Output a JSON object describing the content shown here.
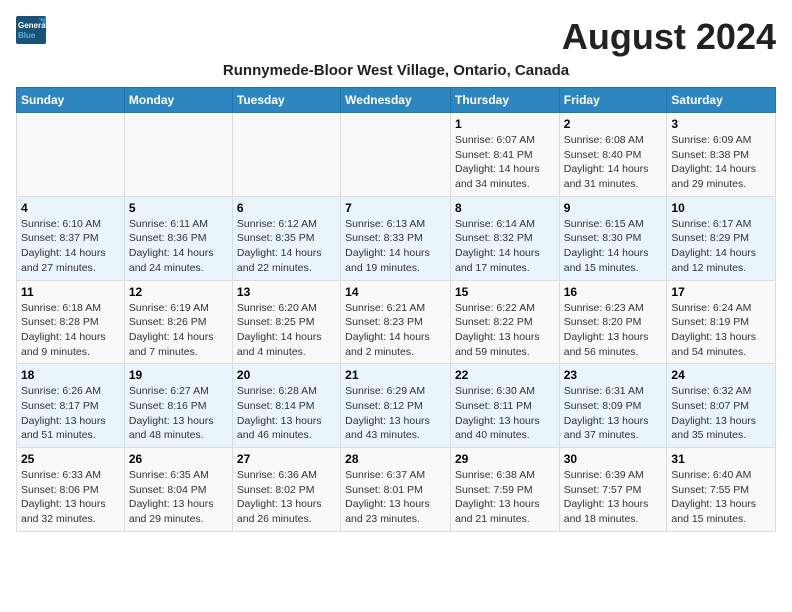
{
  "logo": {
    "line1": "General",
    "line2": "Blue"
  },
  "title": "August 2024",
  "subtitle": "Runnymede-Bloor West Village, Ontario, Canada",
  "days_of_week": [
    "Sunday",
    "Monday",
    "Tuesday",
    "Wednesday",
    "Thursday",
    "Friday",
    "Saturday"
  ],
  "weeks": [
    [
      {
        "day": "",
        "info": ""
      },
      {
        "day": "",
        "info": ""
      },
      {
        "day": "",
        "info": ""
      },
      {
        "day": "",
        "info": ""
      },
      {
        "day": "1",
        "info": "Sunrise: 6:07 AM\nSunset: 8:41 PM\nDaylight: 14 hours\nand 34 minutes."
      },
      {
        "day": "2",
        "info": "Sunrise: 6:08 AM\nSunset: 8:40 PM\nDaylight: 14 hours\nand 31 minutes."
      },
      {
        "day": "3",
        "info": "Sunrise: 6:09 AM\nSunset: 8:38 PM\nDaylight: 14 hours\nand 29 minutes."
      }
    ],
    [
      {
        "day": "4",
        "info": "Sunrise: 6:10 AM\nSunset: 8:37 PM\nDaylight: 14 hours\nand 27 minutes."
      },
      {
        "day": "5",
        "info": "Sunrise: 6:11 AM\nSunset: 8:36 PM\nDaylight: 14 hours\nand 24 minutes."
      },
      {
        "day": "6",
        "info": "Sunrise: 6:12 AM\nSunset: 8:35 PM\nDaylight: 14 hours\nand 22 minutes."
      },
      {
        "day": "7",
        "info": "Sunrise: 6:13 AM\nSunset: 8:33 PM\nDaylight: 14 hours\nand 19 minutes."
      },
      {
        "day": "8",
        "info": "Sunrise: 6:14 AM\nSunset: 8:32 PM\nDaylight: 14 hours\nand 17 minutes."
      },
      {
        "day": "9",
        "info": "Sunrise: 6:15 AM\nSunset: 8:30 PM\nDaylight: 14 hours\nand 15 minutes."
      },
      {
        "day": "10",
        "info": "Sunrise: 6:17 AM\nSunset: 8:29 PM\nDaylight: 14 hours\nand 12 minutes."
      }
    ],
    [
      {
        "day": "11",
        "info": "Sunrise: 6:18 AM\nSunset: 8:28 PM\nDaylight: 14 hours\nand 9 minutes."
      },
      {
        "day": "12",
        "info": "Sunrise: 6:19 AM\nSunset: 8:26 PM\nDaylight: 14 hours\nand 7 minutes."
      },
      {
        "day": "13",
        "info": "Sunrise: 6:20 AM\nSunset: 8:25 PM\nDaylight: 14 hours\nand 4 minutes."
      },
      {
        "day": "14",
        "info": "Sunrise: 6:21 AM\nSunset: 8:23 PM\nDaylight: 14 hours\nand 2 minutes."
      },
      {
        "day": "15",
        "info": "Sunrise: 6:22 AM\nSunset: 8:22 PM\nDaylight: 13 hours\nand 59 minutes."
      },
      {
        "day": "16",
        "info": "Sunrise: 6:23 AM\nSunset: 8:20 PM\nDaylight: 13 hours\nand 56 minutes."
      },
      {
        "day": "17",
        "info": "Sunrise: 6:24 AM\nSunset: 8:19 PM\nDaylight: 13 hours\nand 54 minutes."
      }
    ],
    [
      {
        "day": "18",
        "info": "Sunrise: 6:26 AM\nSunset: 8:17 PM\nDaylight: 13 hours\nand 51 minutes."
      },
      {
        "day": "19",
        "info": "Sunrise: 6:27 AM\nSunset: 8:16 PM\nDaylight: 13 hours\nand 48 minutes."
      },
      {
        "day": "20",
        "info": "Sunrise: 6:28 AM\nSunset: 8:14 PM\nDaylight: 13 hours\nand 46 minutes."
      },
      {
        "day": "21",
        "info": "Sunrise: 6:29 AM\nSunset: 8:12 PM\nDaylight: 13 hours\nand 43 minutes."
      },
      {
        "day": "22",
        "info": "Sunrise: 6:30 AM\nSunset: 8:11 PM\nDaylight: 13 hours\nand 40 minutes."
      },
      {
        "day": "23",
        "info": "Sunrise: 6:31 AM\nSunset: 8:09 PM\nDaylight: 13 hours\nand 37 minutes."
      },
      {
        "day": "24",
        "info": "Sunrise: 6:32 AM\nSunset: 8:07 PM\nDaylight: 13 hours\nand 35 minutes."
      }
    ],
    [
      {
        "day": "25",
        "info": "Sunrise: 6:33 AM\nSunset: 8:06 PM\nDaylight: 13 hours\nand 32 minutes."
      },
      {
        "day": "26",
        "info": "Sunrise: 6:35 AM\nSunset: 8:04 PM\nDaylight: 13 hours\nand 29 minutes."
      },
      {
        "day": "27",
        "info": "Sunrise: 6:36 AM\nSunset: 8:02 PM\nDaylight: 13 hours\nand 26 minutes."
      },
      {
        "day": "28",
        "info": "Sunrise: 6:37 AM\nSunset: 8:01 PM\nDaylight: 13 hours\nand 23 minutes."
      },
      {
        "day": "29",
        "info": "Sunrise: 6:38 AM\nSunset: 7:59 PM\nDaylight: 13 hours\nand 21 minutes."
      },
      {
        "day": "30",
        "info": "Sunrise: 6:39 AM\nSunset: 7:57 PM\nDaylight: 13 hours\nand 18 minutes."
      },
      {
        "day": "31",
        "info": "Sunrise: 6:40 AM\nSunset: 7:55 PM\nDaylight: 13 hours\nand 15 minutes."
      }
    ]
  ]
}
